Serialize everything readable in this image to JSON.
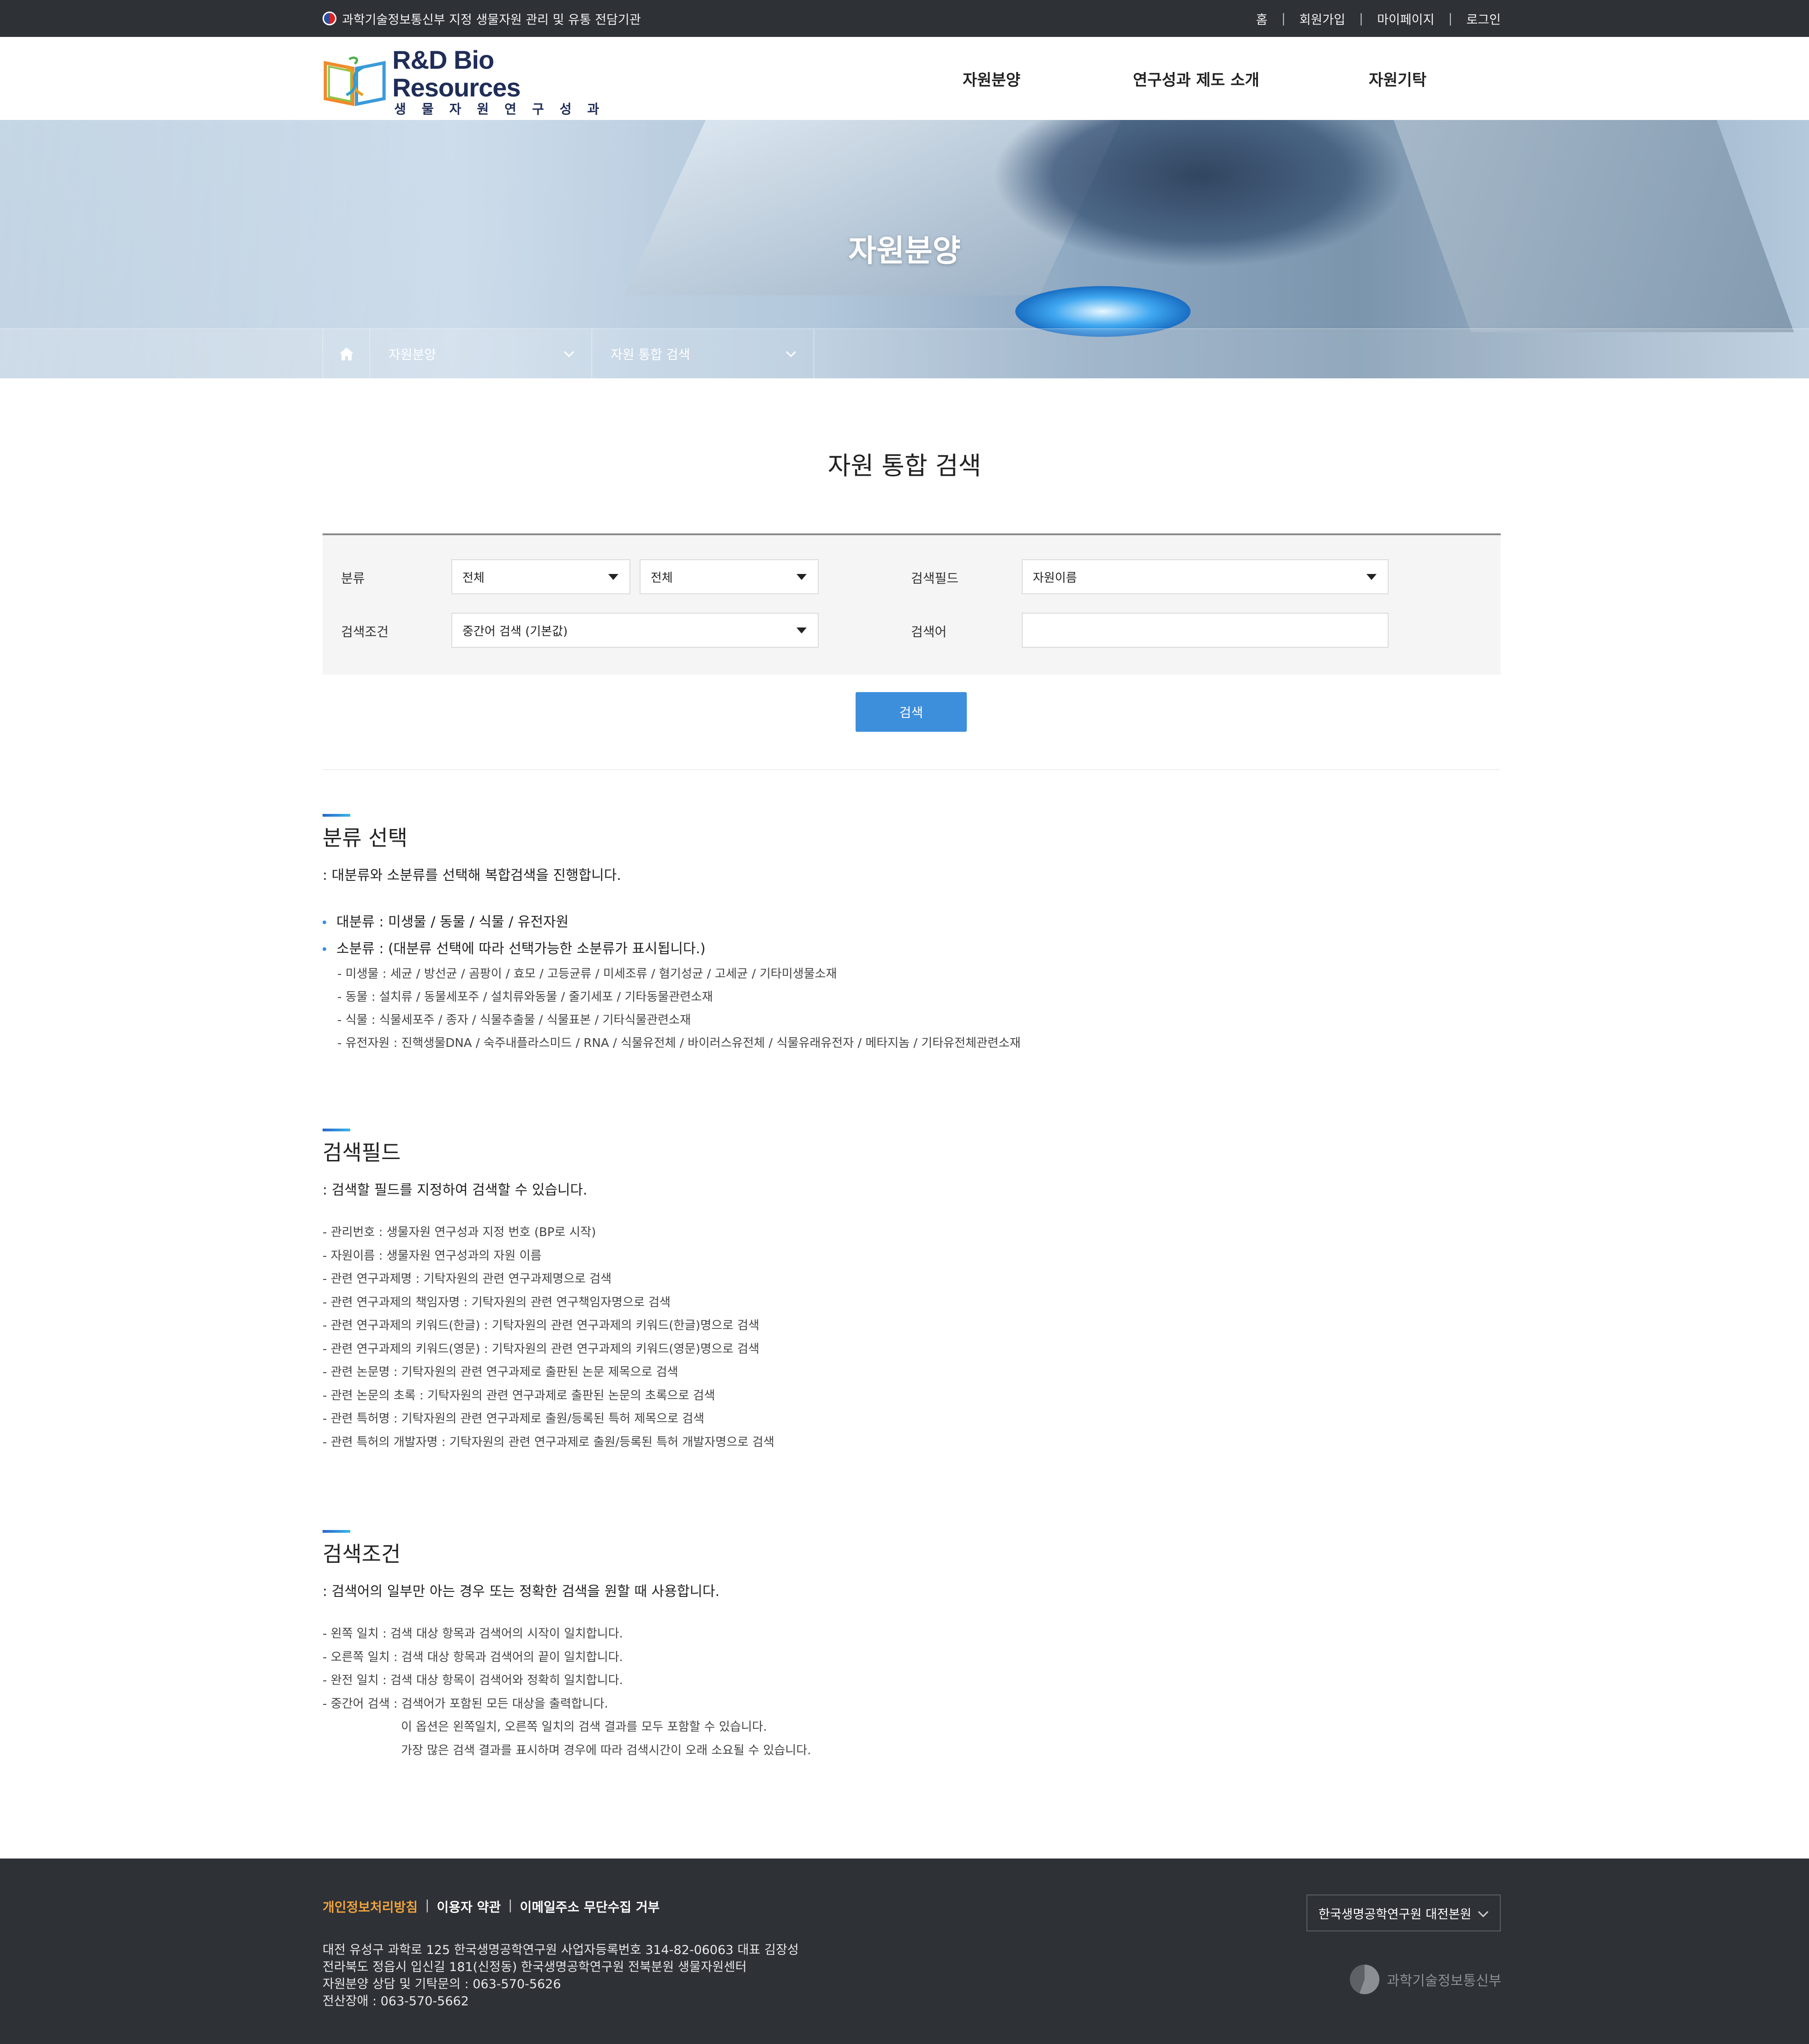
{
  "topbar": {
    "gov_text": "과학기술정보통신부 지정 생물자원 관리 및 유통 전담기관",
    "links": [
      "홈",
      "회원가입",
      "마이페이지",
      "로그인"
    ]
  },
  "header": {
    "logo_title": "R&D Bio Resources",
    "logo_subtitle": "생물자원연구성과",
    "nav": [
      "자원분양",
      "연구성과 제도 소개",
      "자원기탁"
    ]
  },
  "hero": {
    "title": "자원분양",
    "breadcrumb": [
      "자원분양",
      "자원 통합 검색"
    ]
  },
  "page_title": "자원 통합 검색",
  "search": {
    "category_label": "분류",
    "category_major": "전체",
    "category_minor": "전체",
    "field_label": "검색필드",
    "field_value": "자원이름",
    "condition_label": "검색조건",
    "condition_value": "중간어 검색 (기본값)",
    "keyword_label": "검색어",
    "keyword_value": "",
    "button": "검색"
  },
  "section_category": {
    "title": "분류 선택",
    "desc": ": 대분류와 소분류를 선택해 복합검색을 진행합니다.",
    "bullet_major": "대분류 : 미생물 / 동물 / 식물 / 유전자원",
    "bullet_minor": "소분류 : (대분류 선택에 따라 선택가능한 소분류가 표시됩니다.)",
    "subs": [
      "- 미생물 : 세균 / 방선균 / 곰팡이 / 효모 / 고등균류 / 미세조류 / 혐기성균 / 고세균 / 기타미생물소재",
      "- 동물 : 설치류 / 동물세포주 / 설치류와동물 / 줄기세포 / 기타동물관련소재",
      "- 식물 : 식물세포주 / 종자 / 식물추출물 / 식물표본 / 기타식물관련소재",
      "- 유전자원 : 진핵생물DNA / 숙주내플라스미드 / RNA / 식물유전체 / 바이러스유전체 / 식물유래유전자 / 메타지놈 / 기타유전체관련소재"
    ]
  },
  "section_field": {
    "title": "검색필드",
    "desc": ": 검색할 필드를 지정하여 검색할 수 있습니다.",
    "items": [
      "- 관리번호 : 생물자원 연구성과 지정 번호 (BP로 시작)",
      "- 자원이름 : 생물자원 연구성과의 자원 이름",
      "- 관련 연구과제명 : 기탁자원의 관련 연구과제명으로 검색",
      "- 관련 연구과제의 책임자명 : 기탁자원의 관련 연구책임자명으로 검색",
      "- 관련 연구과제의 키워드(한글) : 기탁자원의 관련 연구과제의 키워드(한글)명으로 검색",
      "- 관련 연구과제의 키워드(영문) : 기탁자원의 관련 연구과제의 키워드(영문)명으로 검색",
      "- 관련 논문명 : 기탁자원의 관련 연구과제로 출판된 논문 제목으로 검색",
      "- 관련 논문의 초록 : 기탁자원의 관련 연구과제로 출판된 논문의 초록으로 검색",
      "- 관련 특허명 : 기탁자원의 관련 연구과제로 출원/등록된 특허 제목으로 검색",
      "- 관련 특허의 개발자명 : 기탁자원의 관련 연구과제로 출원/등록된 특허 개발자명으로 검색"
    ]
  },
  "section_condition": {
    "title": "검색조건",
    "desc": ": 검색어의 일부만 아는 경우 또는 정확한 검색을 원할 때 사용합니다.",
    "items": [
      "- 왼쪽 일치 : 검색 대상 항목과 검색어의 시작이 일치합니다.",
      "- 오른쪽 일치 : 검색 대상 항목과 검색어의 끝이 일치합니다.",
      "- 완전 일치 : 검색 대상 항목이 검색어와 정확히 일치합니다.",
      "- 중간어 검색 : 검색어가 포함된 모든 대상을 출력합니다."
    ],
    "notes": [
      "이 옵션은 왼쪽일치, 오른쪽 일치의 검색 결과를 모두 포함할 수 있습니다.",
      "가장 많은 검색 결과를 표시하며 경우에 따라 검색시간이 오래 소요될 수 있습니다."
    ]
  },
  "footer": {
    "privacy": "개인정보처리방침",
    "terms": "이용자 약관",
    "email_policy": "이메일주소 무단수집 거부",
    "address_lines": [
      "대전 유성구 과학로 125 한국생명공학연구원 사업자등록번호 314-82-06063 대표 김장성",
      "전라북도 정읍시 입신길 181(신정동) 한국생명공학연구원 전북분원 생물자원센터",
      "자원분양 상담 및 기탁문의 : 063-570-5626",
      "전산장애 : 063-570-5662"
    ],
    "family_site": "한국생명공학연구원 대전본원",
    "ministry": "과학기술정보통신부"
  }
}
